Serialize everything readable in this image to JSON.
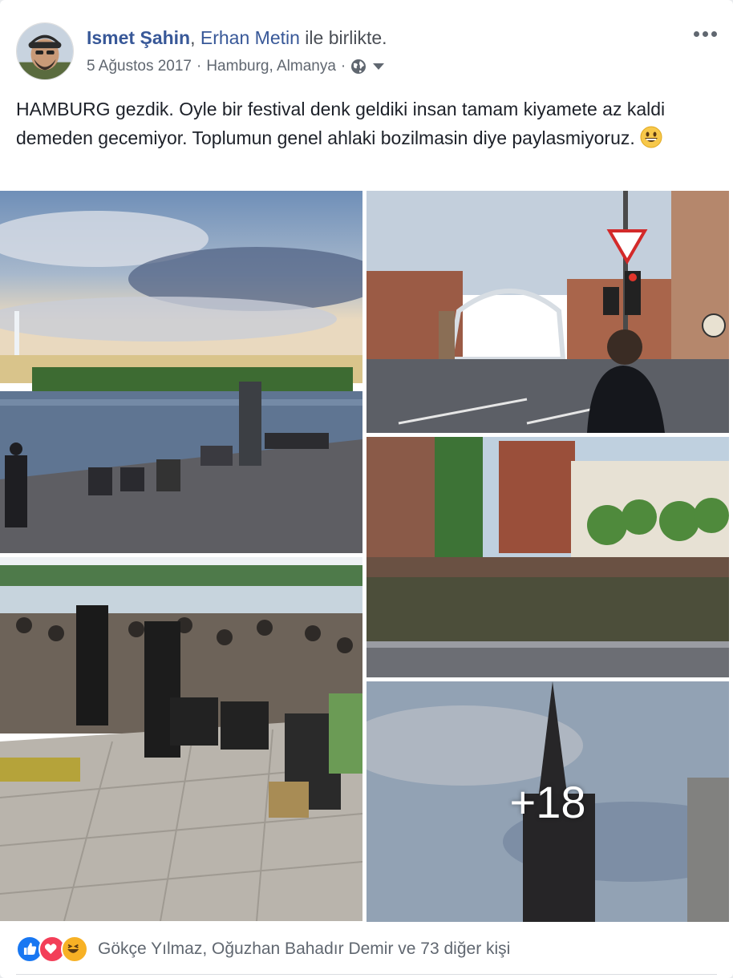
{
  "post": {
    "author": "Ismet Şahin",
    "separator": ",",
    "tagged": "Erhan Metin",
    "with_text": "ile birlikte.",
    "date": "5 Ağustos 2017",
    "dot1": "·",
    "location": "Hamburg, Almanya",
    "dot2": "·",
    "privacy_icon": "globe-icon",
    "text": "HAMBURG gezdik. Oyle bir festival denk geldiki insan tamam kiyamete az kaldi demeden gecemiyor. Toplumun genel ahlaki bozilmasin diye paylasmiyoruz."
  },
  "photos": {
    "items": [
      {
        "name": "photo-alster-lake"
      },
      {
        "name": "photo-bridge-street"
      },
      {
        "name": "photo-festival-crowd"
      },
      {
        "name": "photo-canal"
      },
      {
        "name": "photo-church-tower"
      }
    ],
    "more_count": "+18"
  },
  "reactions": {
    "icons": [
      "like-icon",
      "love-icon",
      "haha-icon"
    ],
    "text": "Gökçe Yılmaz, Oğuzhan Bahadır Demir ve 73 diğer kişi"
  },
  "colors": {
    "link": "#385898",
    "like": "#1877f2",
    "love": "#f33e58",
    "haha": "#f7b125"
  }
}
